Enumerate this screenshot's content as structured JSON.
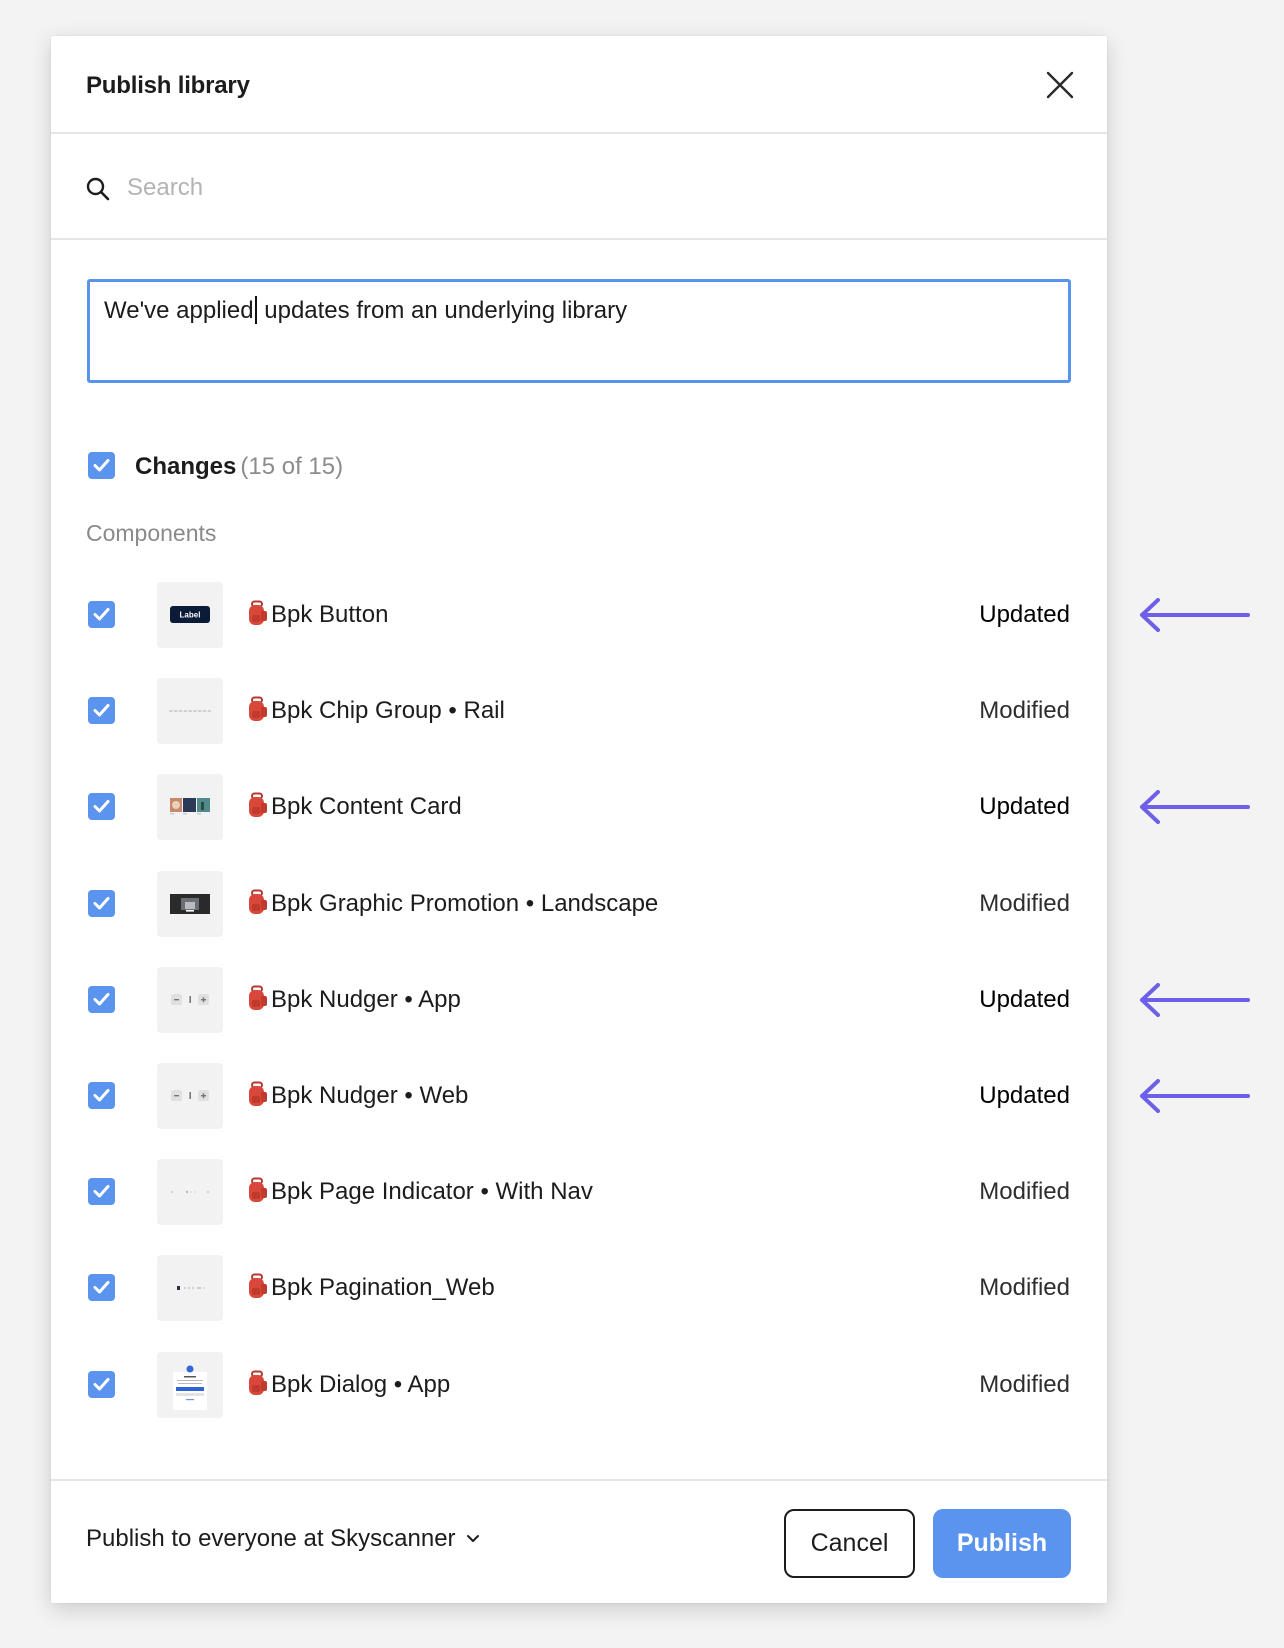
{
  "dialog": {
    "title": "Publish library",
    "close_icon": "close-icon"
  },
  "search": {
    "placeholder": "Search",
    "value": "",
    "icon": "search-icon"
  },
  "message": {
    "text_before_caret": "We've applied",
    "text_after_caret": " updates from an underlying library"
  },
  "changes": {
    "checked": true,
    "label": "Changes",
    "count": "(15 of 15)"
  },
  "section": {
    "label": "Components"
  },
  "components": [
    {
      "name": "Bpk Button",
      "status": "Updated",
      "checked": true,
      "thumbnail": "button-thumbnail",
      "highlighted": true
    },
    {
      "name": "Bpk Chip Group • Rail",
      "status": "Modified",
      "checked": true,
      "thumbnail": "chip-group-thumbnail",
      "highlighted": false
    },
    {
      "name": "Bpk Content Card",
      "status": "Updated",
      "checked": true,
      "thumbnail": "content-card-thumbnail",
      "highlighted": true
    },
    {
      "name": "Bpk Graphic Promotion • Landscape",
      "status": "Modified",
      "checked": true,
      "thumbnail": "graphic-promotion-thumbnail",
      "highlighted": false
    },
    {
      "name": "Bpk Nudger • App",
      "status": "Updated",
      "checked": true,
      "thumbnail": "nudger-thumbnail",
      "highlighted": true
    },
    {
      "name": "Bpk Nudger • Web",
      "status": "Updated",
      "checked": true,
      "thumbnail": "nudger-thumbnail",
      "highlighted": true
    },
    {
      "name": "Bpk Page Indicator • With Nav",
      "status": "Modified",
      "checked": true,
      "thumbnail": "page-indicator-thumbnail",
      "highlighted": false
    },
    {
      "name": "Bpk Pagination_Web",
      "status": "Modified",
      "checked": true,
      "thumbnail": "pagination-thumbnail",
      "highlighted": false
    },
    {
      "name": "Bpk Dialog • App",
      "status": "Modified",
      "checked": true,
      "thumbnail": "dialog-thumbnail",
      "highlighted": false
    }
  ],
  "thumb_text": {
    "button_label": "Label",
    "nudger_app_value": "1",
    "nudger_web_value": "1"
  },
  "footer": {
    "publish_scope": "Publish to everyone at Skyscanner",
    "cancel_label": "Cancel",
    "publish_label": "Publish"
  },
  "colors": {
    "accent": "#5b94ee",
    "annotation_arrow": "#6e5fe8",
    "background": "#f3f3f3"
  }
}
